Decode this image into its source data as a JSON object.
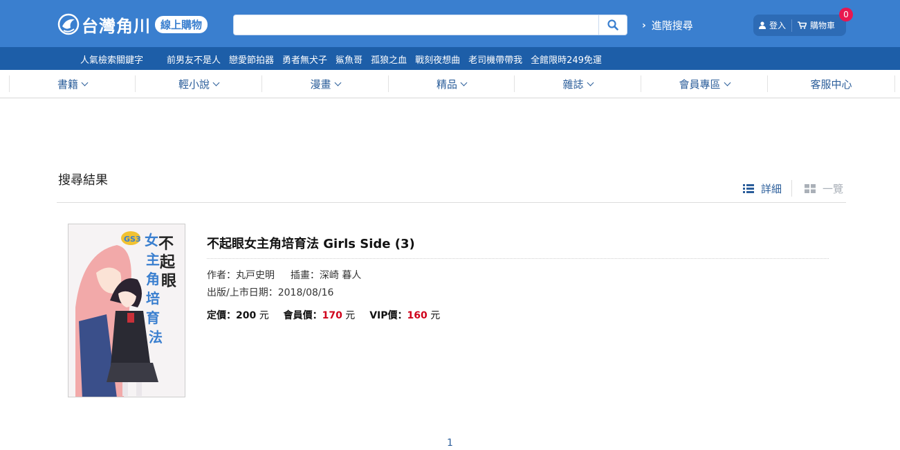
{
  "header": {
    "logo_text": "台灣角川",
    "logo_pill": "線上購物",
    "search": {
      "value": "",
      "placeholder": ""
    },
    "advanced_search": "進階搜尋",
    "login": "登入",
    "cart": "購物車",
    "cart_count": "0"
  },
  "keywords": {
    "title": "人氣檢索關鍵字",
    "items": [
      "前男友不是人",
      "戀愛節拍器",
      "勇者無犬子",
      "鯊魚哥",
      "孤狼之血",
      "戰刻夜想曲",
      "老司機帶帶我",
      "全館限時249免運"
    ]
  },
  "categories": [
    "書籍",
    "輕小說",
    "漫畫",
    "精品",
    "雜誌",
    "會員專區",
    "客服中心"
  ],
  "results": {
    "title": "搜尋結果",
    "view_detail": "詳細",
    "view_grid": "一覽"
  },
  "book": {
    "title": "不起眼女主角培育法 Girls Side (3)",
    "author_label": "作者：",
    "author": "丸戸史明",
    "illustrator_label": "插畫：",
    "illustrator": "深崎 暮人",
    "date_label": "出版/上市日期：",
    "date": "2018/08/16",
    "list_price_label": "定價：",
    "list_price": "200",
    "member_price_label": "會員價：",
    "member_price": "170",
    "vip_price_label": "VIP價：",
    "vip_price": "160",
    "currency": "元",
    "cover_title": "不起眼女主角培育法",
    "cover_badge": "GS-3"
  },
  "pagination": {
    "current": "1"
  },
  "colors": {
    "header": "#3a7fcf",
    "keyword_bar": "#1d5ea8",
    "link": "#2a5d9a",
    "price_red": "#d0021b",
    "badge": "#e8174f"
  }
}
